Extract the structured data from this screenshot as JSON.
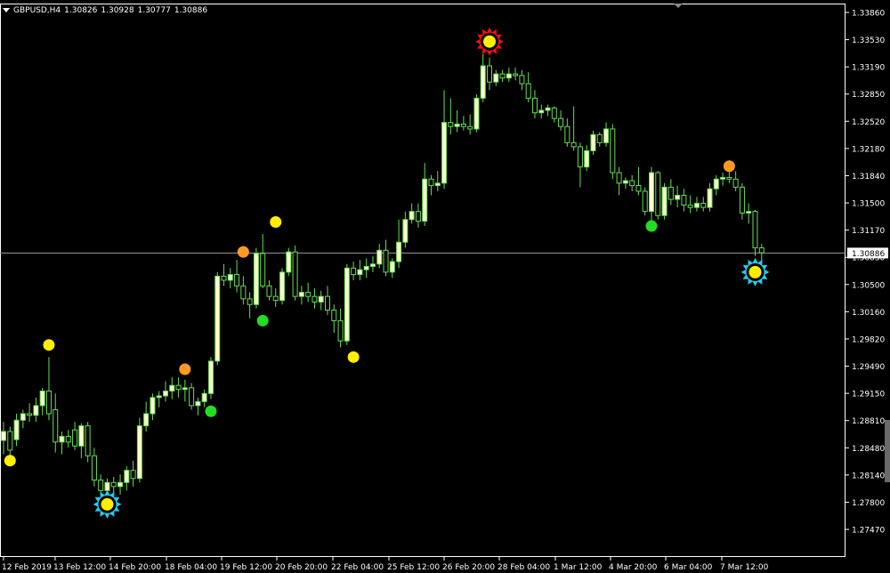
{
  "header": {
    "symbol": "GBPUSD,H4",
    "open": "1.30826",
    "high": "1.30928",
    "low": "1.30777",
    "close": "1.30886"
  },
  "colors": {
    "background": "#000000",
    "axis": "#ffffff",
    "bull_body": "#ffffcc",
    "bear_body": "#000000",
    "wick": "#66dd55",
    "bid_line": "#9a9a9a",
    "dot_yellow": "#ffee00",
    "dot_orange": "#ff9a22",
    "dot_green": "#22dd22",
    "star_red": "#ee1111",
    "star_cyan": "#22ccee"
  },
  "chart_data": {
    "type": "candlestick",
    "timeframe": "H4",
    "y_ticks": [
      "1.33860",
      "1.33530",
      "1.33190",
      "1.32850",
      "1.32520",
      "1.32180",
      "1.31840",
      "1.31500",
      "1.31170",
      "1.30830",
      "1.30500",
      "1.30160",
      "1.29820",
      "1.29490",
      "1.29150",
      "1.28810",
      "1.28480",
      "1.28140",
      "1.27800",
      "1.27470"
    ],
    "ylim": [
      1.2747,
      1.3386
    ],
    "x_ticks": [
      "12 Feb 2019",
      "13 Feb 12:00",
      "14 Feb 20:00",
      "18 Feb 04:00",
      "19 Feb 12:00",
      "20 Feb 20:00",
      "22 Feb 04:00",
      "25 Feb 12:00",
      "26 Feb 20:00",
      "28 Feb 04:00",
      "1 Mar 12:00",
      "4 Mar 20:00",
      "6 Mar 04:00",
      "7 Mar 12:00"
    ],
    "current_price": "1.30886",
    "candles": [
      {
        "o": 1.2857,
        "h": 1.288,
        "l": 1.284,
        "c": 1.2868
      },
      {
        "o": 1.2868,
        "h": 1.2874,
        "l": 1.2838,
        "c": 1.2845
      },
      {
        "o": 1.2858,
        "h": 1.289,
        "l": 1.285,
        "c": 1.2882
      },
      {
        "o": 1.2882,
        "h": 1.2895,
        "l": 1.2872,
        "c": 1.289
      },
      {
        "o": 1.289,
        "h": 1.2903,
        "l": 1.288,
        "c": 1.2888
      },
      {
        "o": 1.2888,
        "h": 1.291,
        "l": 1.288,
        "c": 1.29
      },
      {
        "o": 1.29,
        "h": 1.2922,
        "l": 1.2888,
        "c": 1.2918
      },
      {
        "o": 1.2918,
        "h": 1.296,
        "l": 1.2882,
        "c": 1.289
      },
      {
        "o": 1.2895,
        "h": 1.2915,
        "l": 1.2842,
        "c": 1.2855
      },
      {
        "o": 1.2855,
        "h": 1.2868,
        "l": 1.284,
        "c": 1.2862
      },
      {
        "o": 1.2862,
        "h": 1.287,
        "l": 1.2848,
        "c": 1.2855
      },
      {
        "o": 1.287,
        "h": 1.288,
        "l": 1.2845,
        "c": 1.285
      },
      {
        "o": 1.285,
        "h": 1.2878,
        "l": 1.2835,
        "c": 1.2875
      },
      {
        "o": 1.2875,
        "h": 1.288,
        "l": 1.283,
        "c": 1.2838
      },
      {
        "o": 1.2838,
        "h": 1.2848,
        "l": 1.28,
        "c": 1.2808
      },
      {
        "o": 1.2808,
        "h": 1.2815,
        "l": 1.279,
        "c": 1.2795
      },
      {
        "o": 1.2795,
        "h": 1.281,
        "l": 1.2788,
        "c": 1.2805
      },
      {
        "o": 1.2805,
        "h": 1.2812,
        "l": 1.2792,
        "c": 1.28
      },
      {
        "o": 1.28,
        "h": 1.2815,
        "l": 1.279,
        "c": 1.2805
      },
      {
        "o": 1.2805,
        "h": 1.2825,
        "l": 1.2795,
        "c": 1.282
      },
      {
        "o": 1.282,
        "h": 1.2832,
        "l": 1.28,
        "c": 1.281
      },
      {
        "o": 1.281,
        "h": 1.2885,
        "l": 1.2805,
        "c": 1.2875
      },
      {
        "o": 1.2875,
        "h": 1.2905,
        "l": 1.2868,
        "c": 1.289
      },
      {
        "o": 1.289,
        "h": 1.2915,
        "l": 1.2882,
        "c": 1.291
      },
      {
        "o": 1.291,
        "h": 1.2918,
        "l": 1.2898,
        "c": 1.2912
      },
      {
        "o": 1.2912,
        "h": 1.293,
        "l": 1.2905,
        "c": 1.2918
      },
      {
        "o": 1.2918,
        "h": 1.2935,
        "l": 1.2908,
        "c": 1.2925
      },
      {
        "o": 1.2925,
        "h": 1.2935,
        "l": 1.291,
        "c": 1.292
      },
      {
        "o": 1.292,
        "h": 1.2932,
        "l": 1.2905,
        "c": 1.2922
      },
      {
        "o": 1.2922,
        "h": 1.2928,
        "l": 1.2895,
        "c": 1.29
      },
      {
        "o": 1.29,
        "h": 1.291,
        "l": 1.2888,
        "c": 1.2905
      },
      {
        "o": 1.2905,
        "h": 1.292,
        "l": 1.2898,
        "c": 1.2915
      },
      {
        "o": 1.2915,
        "h": 1.296,
        "l": 1.2908,
        "c": 1.2955
      },
      {
        "o": 1.2955,
        "h": 1.3065,
        "l": 1.295,
        "c": 1.306
      },
      {
        "o": 1.306,
        "h": 1.3075,
        "l": 1.3048,
        "c": 1.3055
      },
      {
        "o": 1.3055,
        "h": 1.307,
        "l": 1.3045,
        "c": 1.3062
      },
      {
        "o": 1.3062,
        "h": 1.308,
        "l": 1.304,
        "c": 1.3048
      },
      {
        "o": 1.3048,
        "h": 1.306,
        "l": 1.3025,
        "c": 1.3032
      },
      {
        "o": 1.3032,
        "h": 1.304,
        "l": 1.3008,
        "c": 1.3025
      },
      {
        "o": 1.3025,
        "h": 1.3095,
        "l": 1.302,
        "c": 1.3088
      },
      {
        "o": 1.3088,
        "h": 1.3112,
        "l": 1.3045,
        "c": 1.3048
      },
      {
        "o": 1.3048,
        "h": 1.3055,
        "l": 1.303,
        "c": 1.3035
      },
      {
        "o": 1.3035,
        "h": 1.3045,
        "l": 1.3022,
        "c": 1.303
      },
      {
        "o": 1.303,
        "h": 1.307,
        "l": 1.3025,
        "c": 1.3065
      },
      {
        "o": 1.3065,
        "h": 1.3095,
        "l": 1.306,
        "c": 1.309
      },
      {
        "o": 1.309,
        "h": 1.3098,
        "l": 1.303,
        "c": 1.3035
      },
      {
        "o": 1.3035,
        "h": 1.3048,
        "l": 1.3025,
        "c": 1.304
      },
      {
        "o": 1.304,
        "h": 1.3052,
        "l": 1.3028,
        "c": 1.3035
      },
      {
        "o": 1.3035,
        "h": 1.3045,
        "l": 1.302,
        "c": 1.3028
      },
      {
        "o": 1.3028,
        "h": 1.3042,
        "l": 1.3018,
        "c": 1.3035
      },
      {
        "o": 1.3035,
        "h": 1.3048,
        "l": 1.3012,
        "c": 1.3018
      },
      {
        "o": 1.3018,
        "h": 1.3025,
        "l": 1.299,
        "c": 1.3005
      },
      {
        "o": 1.3005,
        "h": 1.302,
        "l": 1.2972,
        "c": 1.298
      },
      {
        "o": 1.298,
        "h": 1.3075,
        "l": 1.2975,
        "c": 1.307
      },
      {
        "o": 1.307,
        "h": 1.3078,
        "l": 1.3055,
        "c": 1.3062
      },
      {
        "o": 1.3062,
        "h": 1.308,
        "l": 1.3055,
        "c": 1.3068
      },
      {
        "o": 1.3068,
        "h": 1.3082,
        "l": 1.3058,
        "c": 1.3072
      },
      {
        "o": 1.3072,
        "h": 1.3085,
        "l": 1.3065,
        "c": 1.3075
      },
      {
        "o": 1.3075,
        "h": 1.31,
        "l": 1.307,
        "c": 1.3092
      },
      {
        "o": 1.3092,
        "h": 1.3105,
        "l": 1.306,
        "c": 1.3065
      },
      {
        "o": 1.3065,
        "h": 1.3082,
        "l": 1.3058,
        "c": 1.3078
      },
      {
        "o": 1.3078,
        "h": 1.313,
        "l": 1.307,
        "c": 1.3102
      },
      {
        "o": 1.3102,
        "h": 1.314,
        "l": 1.3095,
        "c": 1.313
      },
      {
        "o": 1.313,
        "h": 1.315,
        "l": 1.3125,
        "c": 1.314
      },
      {
        "o": 1.314,
        "h": 1.315,
        "l": 1.312,
        "c": 1.3128
      },
      {
        "o": 1.3128,
        "h": 1.32,
        "l": 1.3122,
        "c": 1.318
      },
      {
        "o": 1.318,
        "h": 1.3185,
        "l": 1.316,
        "c": 1.3172
      },
      {
        "o": 1.3172,
        "h": 1.319,
        "l": 1.3165,
        "c": 1.3175
      },
      {
        "o": 1.3175,
        "h": 1.329,
        "l": 1.3168,
        "c": 1.325
      },
      {
        "o": 1.325,
        "h": 1.328,
        "l": 1.3235,
        "c": 1.3245
      },
      {
        "o": 1.3245,
        "h": 1.3265,
        "l": 1.3238,
        "c": 1.3248
      },
      {
        "o": 1.3248,
        "h": 1.3258,
        "l": 1.324,
        "c": 1.3245
      },
      {
        "o": 1.3245,
        "h": 1.326,
        "l": 1.3235,
        "c": 1.3242
      },
      {
        "o": 1.3242,
        "h": 1.3285,
        "l": 1.3238,
        "c": 1.328
      },
      {
        "o": 1.328,
        "h": 1.3335,
        "l": 1.3275,
        "c": 1.332
      },
      {
        "o": 1.332,
        "h": 1.333,
        "l": 1.329,
        "c": 1.33
      },
      {
        "o": 1.33,
        "h": 1.3315,
        "l": 1.3295,
        "c": 1.331
      },
      {
        "o": 1.331,
        "h": 1.3315,
        "l": 1.33,
        "c": 1.3305
      },
      {
        "o": 1.3305,
        "h": 1.3318,
        "l": 1.33,
        "c": 1.331
      },
      {
        "o": 1.331,
        "h": 1.3318,
        "l": 1.3302,
        "c": 1.3308
      },
      {
        "o": 1.3308,
        "h": 1.3315,
        "l": 1.329,
        "c": 1.3298
      },
      {
        "o": 1.3298,
        "h": 1.3312,
        "l": 1.3275,
        "c": 1.328
      },
      {
        "o": 1.328,
        "h": 1.329,
        "l": 1.3255,
        "c": 1.3262
      },
      {
        "o": 1.3262,
        "h": 1.3272,
        "l": 1.3255,
        "c": 1.3265
      },
      {
        "o": 1.3265,
        "h": 1.3272,
        "l": 1.3258,
        "c": 1.3268
      },
      {
        "o": 1.3268,
        "h": 1.327,
        "l": 1.325,
        "c": 1.3255
      },
      {
        "o": 1.3255,
        "h": 1.3265,
        "l": 1.324,
        "c": 1.3245
      },
      {
        "o": 1.3245,
        "h": 1.3255,
        "l": 1.322,
        "c": 1.3225
      },
      {
        "o": 1.3225,
        "h": 1.327,
        "l": 1.3215,
        "c": 1.322
      },
      {
        "o": 1.322,
        "h": 1.3225,
        "l": 1.317,
        "c": 1.3195
      },
      {
        "o": 1.3195,
        "h": 1.3222,
        "l": 1.319,
        "c": 1.3215
      },
      {
        "o": 1.3215,
        "h": 1.324,
        "l": 1.321,
        "c": 1.3235
      },
      {
        "o": 1.3235,
        "h": 1.3238,
        "l": 1.322,
        "c": 1.3225
      },
      {
        "o": 1.3225,
        "h": 1.325,
        "l": 1.322,
        "c": 1.3242
      },
      {
        "o": 1.3242,
        "h": 1.3248,
        "l": 1.318,
        "c": 1.3188
      },
      {
        "o": 1.3188,
        "h": 1.3195,
        "l": 1.316,
        "c": 1.3175
      },
      {
        "o": 1.3175,
        "h": 1.3182,
        "l": 1.3168,
        "c": 1.3178
      },
      {
        "o": 1.3178,
        "h": 1.3185,
        "l": 1.3165,
        "c": 1.3172
      },
      {
        "o": 1.3172,
        "h": 1.3195,
        "l": 1.316,
        "c": 1.3165
      },
      {
        "o": 1.3165,
        "h": 1.317,
        "l": 1.3135,
        "c": 1.314
      },
      {
        "o": 1.314,
        "h": 1.3195,
        "l": 1.3125,
        "c": 1.3188
      },
      {
        "o": 1.3188,
        "h": 1.319,
        "l": 1.313,
        "c": 1.3135
      },
      {
        "o": 1.3135,
        "h": 1.3175,
        "l": 1.313,
        "c": 1.317
      },
      {
        "o": 1.317,
        "h": 1.318,
        "l": 1.3148,
        "c": 1.3155
      },
      {
        "o": 1.3155,
        "h": 1.3172,
        "l": 1.3145,
        "c": 1.316
      },
      {
        "o": 1.316,
        "h": 1.3168,
        "l": 1.314,
        "c": 1.3148
      },
      {
        "o": 1.3148,
        "h": 1.316,
        "l": 1.3138,
        "c": 1.3145
      },
      {
        "o": 1.3145,
        "h": 1.3158,
        "l": 1.314,
        "c": 1.315
      },
      {
        "o": 1.315,
        "h": 1.3158,
        "l": 1.314,
        "c": 1.3145
      },
      {
        "o": 1.3145,
        "h": 1.3175,
        "l": 1.314,
        "c": 1.3168
      },
      {
        "o": 1.3168,
        "h": 1.3185,
        "l": 1.316,
        "c": 1.318
      },
      {
        "o": 1.318,
        "h": 1.3188,
        "l": 1.3172,
        "c": 1.3182
      },
      {
        "o": 1.3182,
        "h": 1.319,
        "l": 1.3175,
        "c": 1.318
      },
      {
        "o": 1.318,
        "h": 1.319,
        "l": 1.3165,
        "c": 1.317
      },
      {
        "o": 1.317,
        "h": 1.3175,
        "l": 1.313,
        "c": 1.3138
      },
      {
        "o": 1.3138,
        "h": 1.315,
        "l": 1.3125,
        "c": 1.314
      },
      {
        "o": 1.314,
        "h": 1.3142,
        "l": 1.3085,
        "c": 1.3095
      },
      {
        "o": 1.3095,
        "h": 1.31,
        "l": 1.3075,
        "c": 1.3089
      }
    ],
    "markers": [
      {
        "i": 1,
        "price": 1.2832,
        "kind": "dot",
        "color": "#ffee00",
        "side": "below"
      },
      {
        "i": 7,
        "price": 1.2975,
        "kind": "dot",
        "color": "#ffee00",
        "side": "above"
      },
      {
        "i": 16,
        "price": 1.2778,
        "kind": "star",
        "color": "#22ccee",
        "side": "below"
      },
      {
        "i": 28,
        "price": 1.2945,
        "kind": "dot",
        "color": "#ff9a22",
        "side": "above"
      },
      {
        "i": 32,
        "price": 1.2893,
        "kind": "dot",
        "color": "#22dd22",
        "side": "below"
      },
      {
        "i": 37,
        "price": 1.309,
        "kind": "dot",
        "color": "#ff9a22",
        "side": "above"
      },
      {
        "i": 40,
        "price": 1.3005,
        "kind": "dot",
        "color": "#22dd22",
        "side": "below"
      },
      {
        "i": 42,
        "price": 1.3127,
        "kind": "dot",
        "color": "#ffee00",
        "side": "above"
      },
      {
        "i": 54,
        "price": 1.296,
        "kind": "dot",
        "color": "#ffee00",
        "side": "below"
      },
      {
        "i": 75,
        "price": 1.335,
        "kind": "star",
        "color": "#ee1111",
        "side": "above"
      },
      {
        "i": 100,
        "price": 1.3122,
        "kind": "dot",
        "color": "#22dd22",
        "side": "below"
      },
      {
        "i": 112,
        "price": 1.3196,
        "kind": "dot",
        "color": "#ff9a22",
        "side": "above"
      },
      {
        "i": 116,
        "price": 1.3065,
        "kind": "star",
        "color": "#22ccee",
        "side": "below"
      }
    ]
  }
}
